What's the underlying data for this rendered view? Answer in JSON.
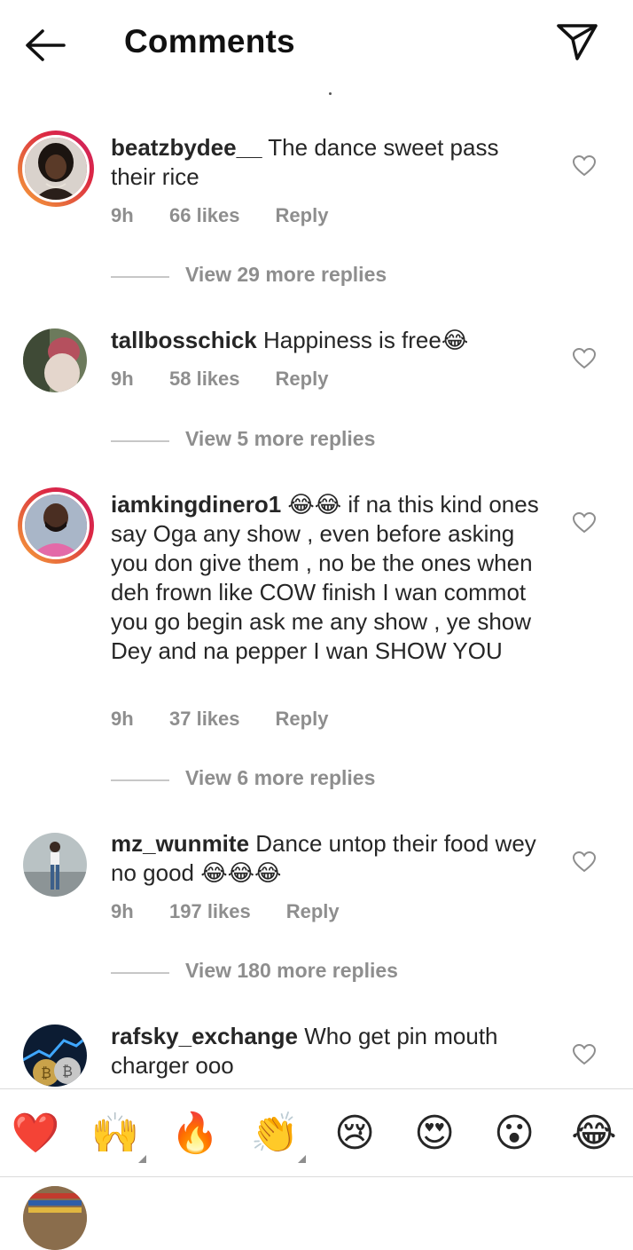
{
  "header": {
    "title": "Comments"
  },
  "comments": [
    {
      "username": "beatzbydee__",
      "text": "The dance sweet pass their rice",
      "time": "9h",
      "likes": "66 likes",
      "reply": "Reply",
      "view_replies": "View 29 more replies",
      "story_ring": true
    },
    {
      "username": "tallbosschick",
      "text": "Happiness is free😂",
      "time": "9h",
      "likes": "58 likes",
      "reply": "Reply",
      "view_replies": "View 5 more replies",
      "story_ring": false
    },
    {
      "username": "iamkingdinero1",
      "text": "😂😂 if na this kind ones say Oga any show , even before asking you don give them , no be the ones when deh frown like COW finish I wan commot you go begin ask me any show , ye show Dey and na pepper I wan SHOW YOU",
      "time": "9h",
      "likes": "37 likes",
      "reply": "Reply",
      "view_replies": "View 6 more replies",
      "story_ring": true
    },
    {
      "username": "mz_wunmite",
      "text": "Dance untop their food wey no good 😂😂😂",
      "time": "9h",
      "likes": "197 likes",
      "reply": "Reply",
      "view_replies": "View 180 more replies",
      "story_ring": false
    },
    {
      "username": "rafsky_exchange",
      "text": "Who get pin mouth charger ooo",
      "story_ring": false
    }
  ],
  "quick_reactions": [
    {
      "icon": "red-heart-icon",
      "glyph": "❤️"
    },
    {
      "icon": "raising-hands-icon",
      "glyph": "🙌"
    },
    {
      "icon": "fire-icon",
      "glyph": "🔥"
    },
    {
      "icon": "clapping-hands-icon",
      "glyph": "👏"
    },
    {
      "icon": "crying-face-icon",
      "glyph": "😢"
    },
    {
      "icon": "heart-eyes-icon",
      "glyph": "😍"
    },
    {
      "icon": "surprised-face-icon",
      "glyph": "😮"
    },
    {
      "icon": "tears-of-joy-icon",
      "glyph": "😂"
    }
  ]
}
